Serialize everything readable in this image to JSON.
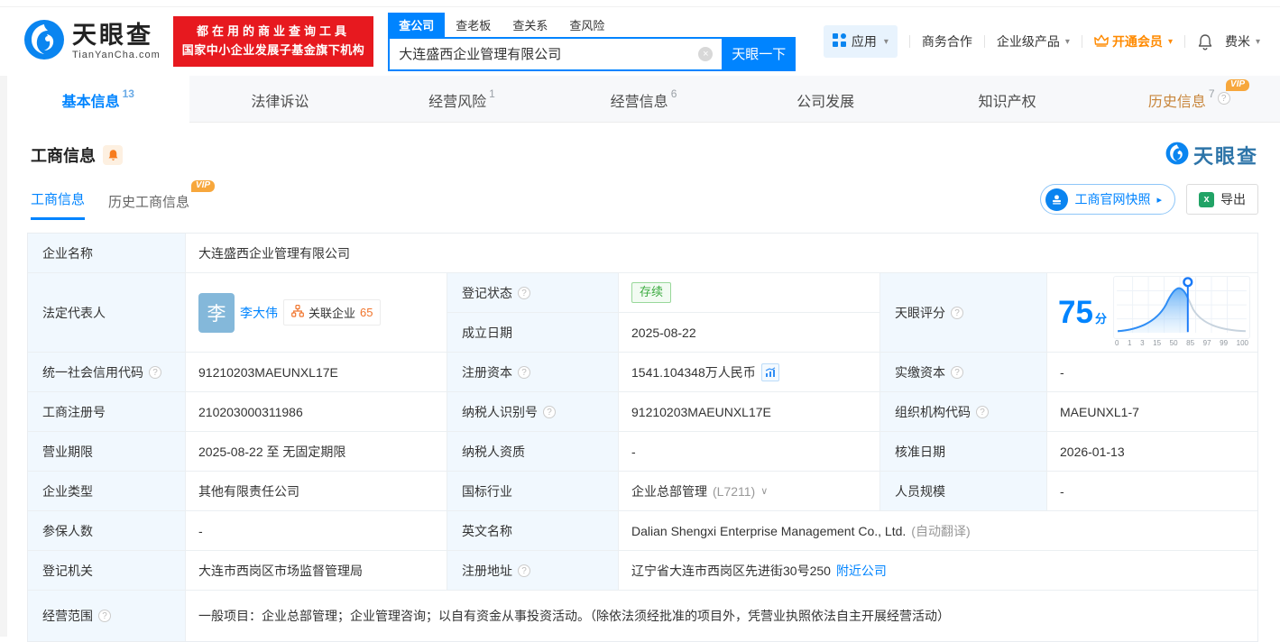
{
  "colors": {
    "primary": "#0084ff",
    "orange": "#ff8a00",
    "red": "#e7191f",
    "green": "#3cab40"
  },
  "icons": {
    "help": "?",
    "caret_down": "▾",
    "chevron_down": "∨",
    "arrow_right": "▸",
    "clear": "×",
    "excel": "x"
  },
  "header": {
    "logo_title": "天眼查",
    "logo_domain": "TianYanCha.com",
    "banner_line1": "都在用的商业查询工具",
    "banner_line2": "国家中小企业发展子基金旗下机构",
    "search_tabs": [
      {
        "label": "查公司"
      },
      {
        "label": "查老板"
      },
      {
        "label": "查关系"
      },
      {
        "label": "查风险"
      }
    ],
    "search_value": "大连盛西企业管理有限公司",
    "search_button": "天眼一下",
    "nav_apps": "应用",
    "nav_cooperation": "商务合作",
    "nav_enterprise": "企业级产品",
    "nav_vip": "开通会员",
    "nav_user": "费米"
  },
  "tabs": [
    {
      "label": "基本信息",
      "count": "13"
    },
    {
      "label": "法律诉讼",
      "count": ""
    },
    {
      "label": "经营风险",
      "count": "1"
    },
    {
      "label": "经营信息",
      "count": "6"
    },
    {
      "label": "公司发展",
      "count": ""
    },
    {
      "label": "知识产权",
      "count": ""
    },
    {
      "label": "历史信息",
      "count": "7",
      "vip": "VIP"
    }
  ],
  "section": {
    "title": "工商信息",
    "watermark": "天眼查",
    "subtab_active": "工商信息",
    "subtab_history": "历史工商信息",
    "vip_badge": "VIP",
    "snapshot_button": "工商官网快照",
    "export_button": "导出"
  },
  "score": {
    "label": "天眼评分",
    "value": "75",
    "unit": "分",
    "axis": [
      "0",
      "1",
      "3",
      "15",
      "50",
      "85",
      "97",
      "99",
      "100"
    ]
  },
  "fields": {
    "company_name": {
      "label": "企业名称",
      "value": "大连盛西企业管理有限公司"
    },
    "legal_rep": {
      "label": "法定代表人",
      "avatar": "李",
      "name": "李大伟",
      "badge": "关联企业",
      "badge_count": "65"
    },
    "reg_status": {
      "label": "登记状态",
      "value": "存续"
    },
    "establish_date": {
      "label": "成立日期",
      "value": "2025-08-22"
    },
    "credit_code": {
      "label": "统一社会信用代码",
      "value": "91210203MAEUNXL17E"
    },
    "reg_capital": {
      "label": "注册资本",
      "value": "1541.104348万人民币"
    },
    "paid_capital": {
      "label": "实缴资本",
      "value": "-"
    },
    "reg_number": {
      "label": "工商注册号",
      "value": "210203000311986"
    },
    "taxpayer_id": {
      "label": "纳税人识别号",
      "value": "91210203MAEUNXL17E"
    },
    "org_code": {
      "label": "组织机构代码",
      "value": "MAEUNXL1-7"
    },
    "business_term": {
      "label": "营业期限",
      "value": "2025-08-22 至 无固定期限"
    },
    "taxpayer_quality": {
      "label": "纳税人资质",
      "value": "-"
    },
    "approval_date": {
      "label": "核准日期",
      "value": "2026-01-13"
    },
    "company_type": {
      "label": "企业类型",
      "value": "其他有限责任公司"
    },
    "industry": {
      "label": "国标行业",
      "value": "企业总部管理",
      "code": "(L7211)"
    },
    "staff_size": {
      "label": "人员规模",
      "value": "-"
    },
    "insured_count": {
      "label": "参保人数",
      "value": "-"
    },
    "english_name": {
      "label": "英文名称",
      "value": "Dalian Shengxi Enterprise Management Co., Ltd.",
      "note": "(自动翻译)"
    },
    "reg_authority": {
      "label": "登记机关",
      "value": "大连市西岗区市场监督管理局"
    },
    "reg_address": {
      "label": "注册地址",
      "value": "辽宁省大连市西岗区先进街30号250",
      "link": "附近公司"
    },
    "business_scope": {
      "label": "经营范围",
      "value": "一般项目：企业总部管理；企业管理咨询；以自有资金从事投资活动。（除依法须经批准的项目外，凭营业执照依法自主开展经营活动）"
    }
  }
}
